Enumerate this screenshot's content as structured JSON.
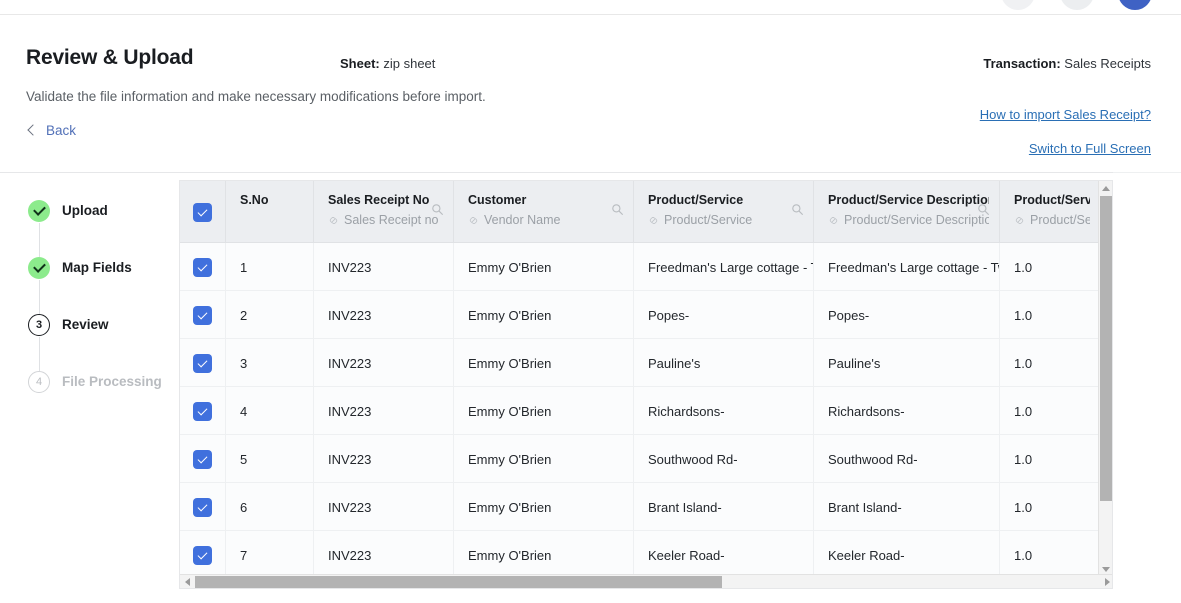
{
  "header": {
    "title": "Review & Upload",
    "subtitle": "Validate the file information and make necessary modifications before import.",
    "back_label": "Back",
    "back_icon": "chevron-left-icon",
    "sheet_label": "Sheet:",
    "sheet_value": "zip sheet",
    "transaction_label": "Transaction:",
    "transaction_value": "Sales Receipts",
    "help_link": "How to import Sales Receipt?",
    "fullscreen_link": "Switch to Full Screen"
  },
  "stepper": {
    "steps": [
      {
        "label": "Upload",
        "state": "done",
        "num": "1",
        "icon": "check-icon"
      },
      {
        "label": "Map Fields",
        "state": "done",
        "num": "2",
        "icon": "check-icon"
      },
      {
        "label": "Review",
        "state": "current",
        "num": "3",
        "icon": ""
      },
      {
        "label": "File Processing",
        "state": "pending",
        "num": "4",
        "icon": ""
      }
    ]
  },
  "table": {
    "select_all_checked": true,
    "columns": [
      {
        "key": "checkbox",
        "main": "",
        "sub": "",
        "search": false
      },
      {
        "key": "sno",
        "main": "S.No",
        "sub": "",
        "search": false
      },
      {
        "key": "sales_receipt_no",
        "main": "Sales Receipt No",
        "sub": "Sales Receipt no",
        "search": true
      },
      {
        "key": "customer",
        "main": "Customer",
        "sub": "Vendor Name",
        "search": true
      },
      {
        "key": "product_service",
        "main": "Product/Service",
        "sub": "Product/Service",
        "search": true
      },
      {
        "key": "product_service_description",
        "main": "Product/Service Description",
        "sub": "Product/Service Description",
        "search": true
      },
      {
        "key": "product_service_qty",
        "main": "Product/Servic",
        "sub": "Product/Ser",
        "search": false
      }
    ],
    "rows": [
      {
        "checked": true,
        "sno": "1",
        "sales_receipt_no": "INV223",
        "customer": "Emmy O'Brien",
        "product_service": "Freedman's Large cottage - Tw",
        "product_service_description": "Freedman's Large cottage - Tw",
        "product_service_qty": "1.0"
      },
      {
        "checked": true,
        "sno": "2",
        "sales_receipt_no": "INV223",
        "customer": "Emmy O'Brien",
        "product_service": "Popes-",
        "product_service_description": "Popes-",
        "product_service_qty": "1.0"
      },
      {
        "checked": true,
        "sno": "3",
        "sales_receipt_no": "INV223",
        "customer": "Emmy O'Brien",
        "product_service": "Pauline's",
        "product_service_description": "Pauline's",
        "product_service_qty": "1.0"
      },
      {
        "checked": true,
        "sno": "4",
        "sales_receipt_no": "INV223",
        "customer": "Emmy O'Brien",
        "product_service": "Richardsons-",
        "product_service_description": "Richardsons-",
        "product_service_qty": "1.0"
      },
      {
        "checked": true,
        "sno": "5",
        "sales_receipt_no": "INV223",
        "customer": "Emmy O'Brien",
        "product_service": "Southwood Rd-",
        "product_service_description": "Southwood Rd-",
        "product_service_qty": "1.0"
      },
      {
        "checked": true,
        "sno": "6",
        "sales_receipt_no": "INV223",
        "customer": "Emmy O'Brien",
        "product_service": "Brant Island-",
        "product_service_description": "Brant Island-",
        "product_service_qty": "1.0"
      },
      {
        "checked": true,
        "sno": "7",
        "sales_receipt_no": "INV223",
        "customer": "Emmy O'Brien",
        "product_service": "Keeler Road-",
        "product_service_description": "Keeler Road-",
        "product_service_qty": "1.0"
      }
    ]
  },
  "colors": {
    "accent_blue": "#4070dd",
    "link_blue": "#2a6fb5",
    "step_done_green": "#8ceb8c",
    "header_bg": "#eceef1"
  }
}
